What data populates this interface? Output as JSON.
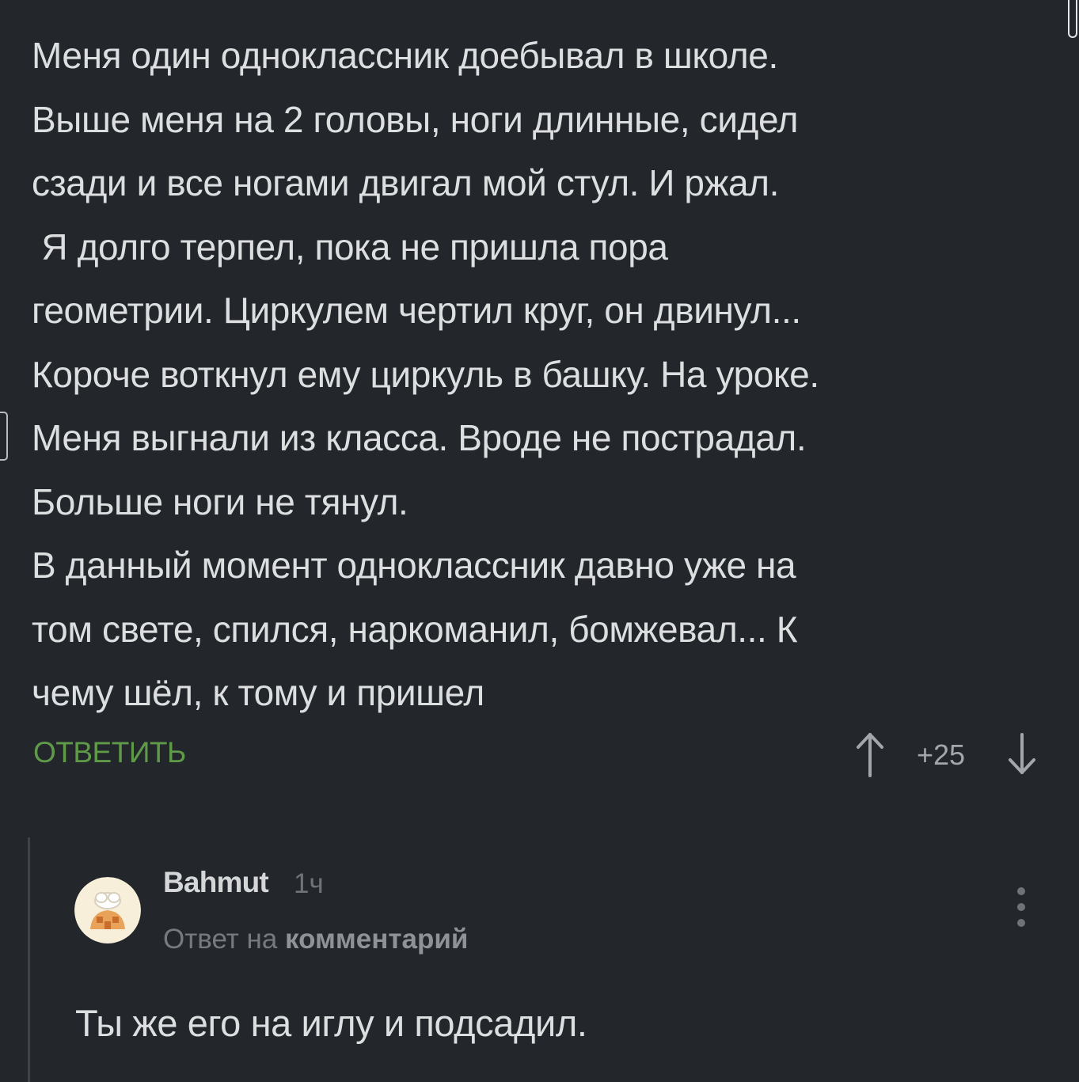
{
  "comment": {
    "lines": [
      "Меня один одноклассник доебывал в школе.",
      "Выше меня на 2 головы, ноги длинные, сидел",
      "сзади и все ногами двигал мой стул. И ржал.",
      " Я долго терпел, пока не пришла пора",
      "геометрии. Циркулем чертил круг, он двинул...",
      "Короче воткнул ему циркуль в башку. На уроке.",
      "Меня выгнали из класса. Вроде не пострадал.",
      "Больше ноги не тянул.",
      "В данный момент одноклассник давно уже на",
      "том свете, спился, наркоманил, бомжевал... К",
      "чему шёл, к тому и пришел"
    ],
    "reply_label": "ОТВЕТИТЬ",
    "rating": "+25",
    "icons": {
      "upvote": "arrow-up-icon",
      "downvote": "arrow-down-icon"
    }
  },
  "reply": {
    "author": "Bahmut",
    "time": "1ч",
    "reply_to_prefix": "Ответ на",
    "reply_to_link": "комментарий",
    "text": "Ты же его на иглу и подсадил.",
    "icons": {
      "avatar": "avatar-icon",
      "menu": "more-vertical-icon"
    }
  },
  "colors": {
    "background": "#23272b",
    "text": "#dcdee0",
    "accent_green": "#5f9a48",
    "muted": "#767a7f"
  }
}
